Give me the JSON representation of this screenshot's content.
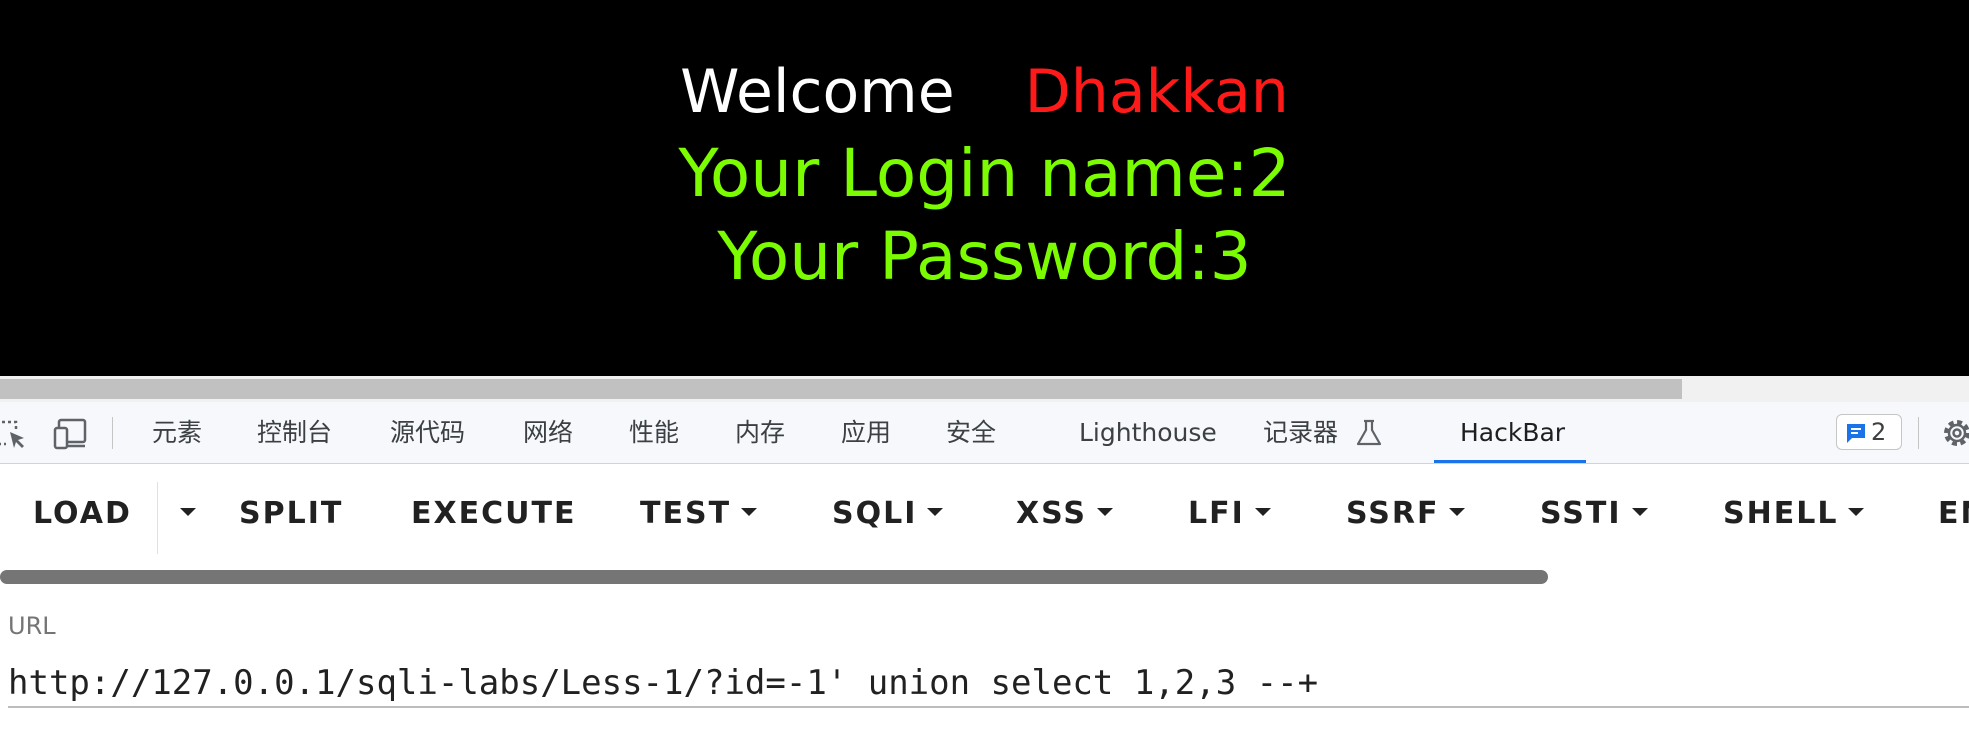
{
  "page": {
    "welcome_word": "Welcome",
    "welcome_name": "Dhakkan",
    "login_line": "Your Login name:2",
    "password_line": "Your Password:3"
  },
  "devtools": {
    "tabs": [
      "元素",
      "控制台",
      "源代码",
      "网络",
      "性能",
      "内存",
      "应用",
      "安全",
      "Lighthouse",
      "记录器",
      "HackBar"
    ],
    "active_tab": "HackBar",
    "issues_count": "2",
    "icons": [
      "inspect-element-icon",
      "device-toolbar-icon",
      "flask-icon",
      "issues-icon",
      "gear-icon"
    ]
  },
  "hackbar": {
    "buttons": [
      "LOAD",
      "SPLIT",
      "EXECUTE",
      "TEST",
      "SQLI",
      "XSS",
      "LFI",
      "SSRF",
      "SSTI",
      "SHELL",
      "EN"
    ],
    "url_label": "URL",
    "url_value": "http://127.0.0.1/sqli-labs/Less-1/?id=-1' union select 1,2,3 --+"
  },
  "colors": {
    "welcome": "#ffffff",
    "name": "#ff1a1a",
    "result": "#7cfc00",
    "accent": "#1a73e8"
  }
}
